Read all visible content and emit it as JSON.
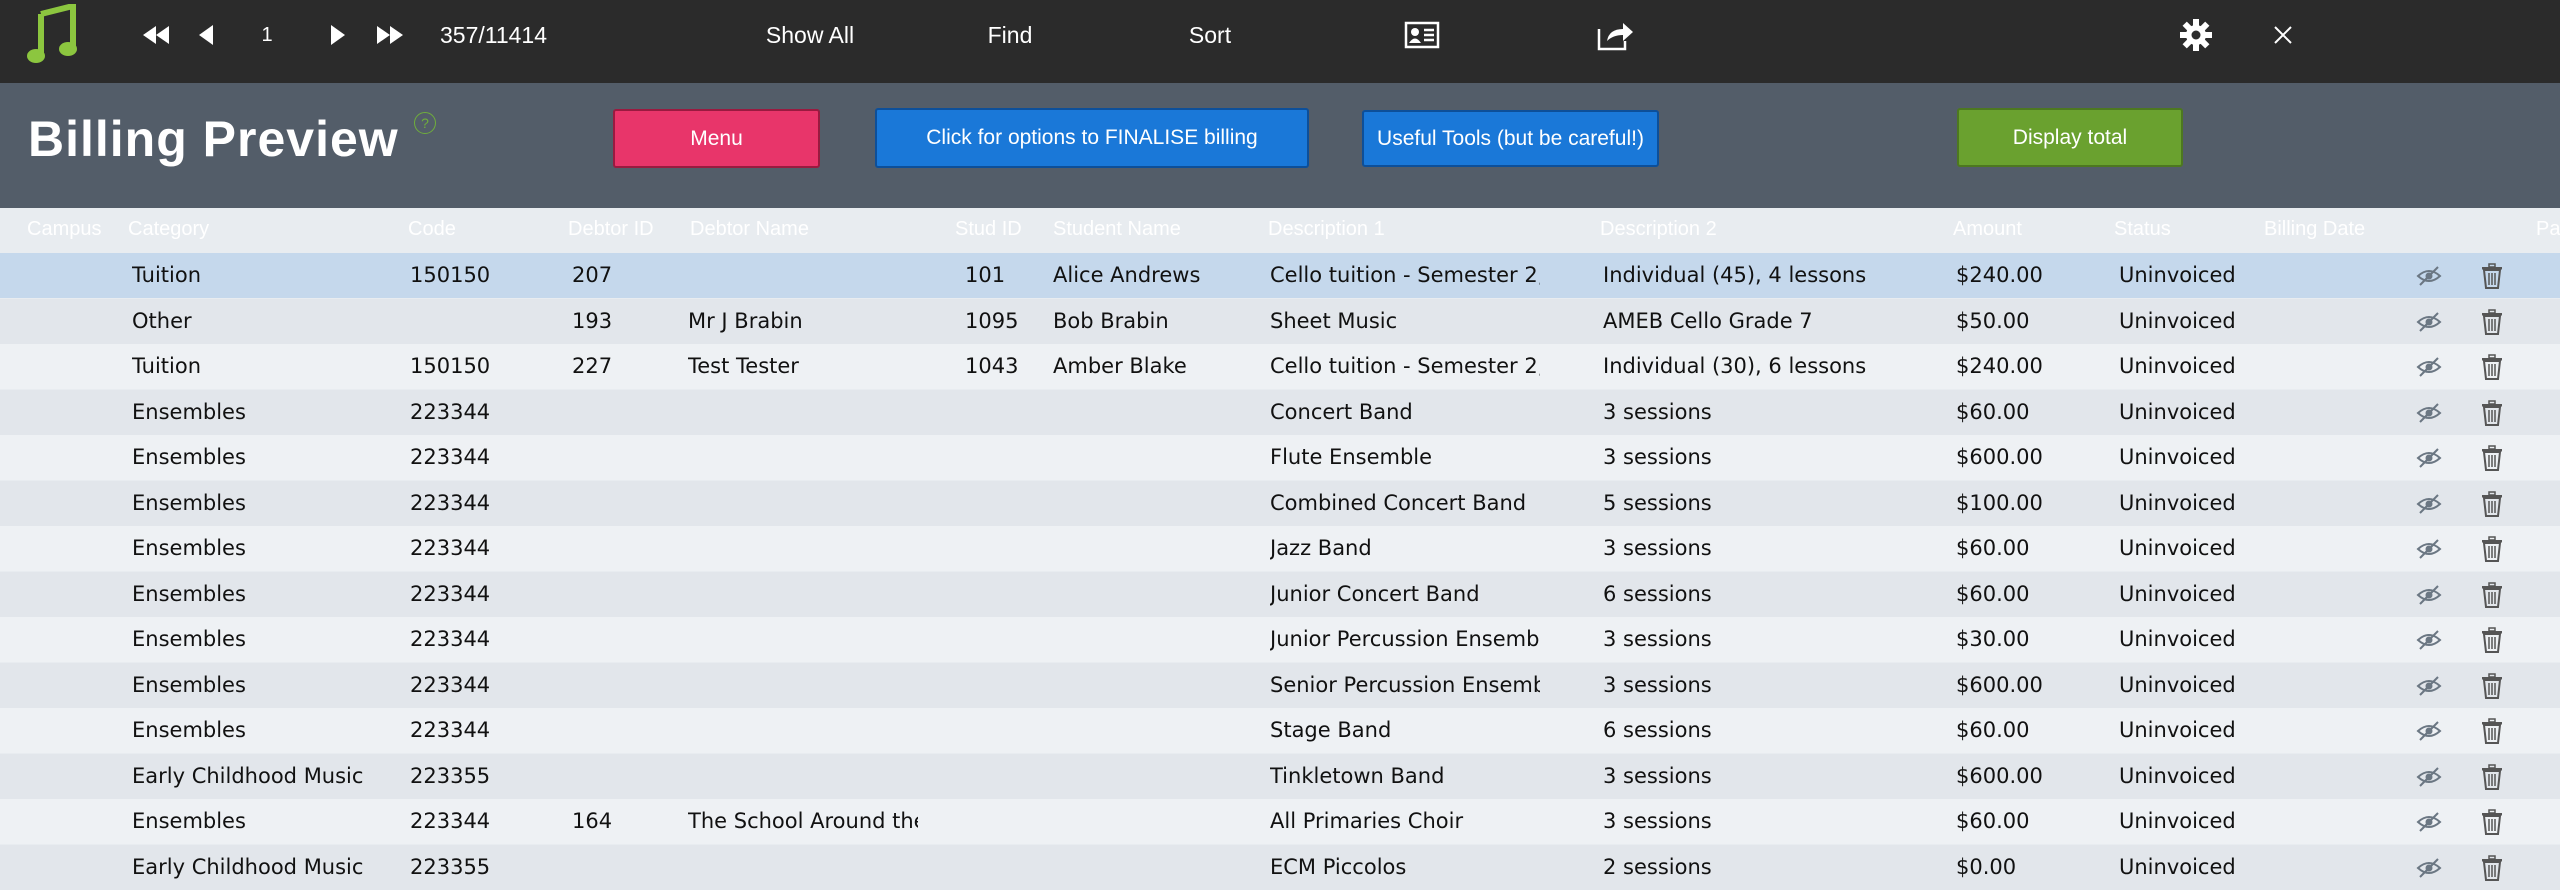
{
  "toolbar": {
    "record_current": "1",
    "record_count": "357/11414",
    "show_all": "Show All",
    "find": "Find",
    "sort": "Sort"
  },
  "header": {
    "title": "Billing Preview",
    "help": "?",
    "menu_button": "Menu",
    "finalise_button": "Click for options to FINALISE billing",
    "tools_button": "Useful Tools (but be careful!)",
    "total_button": "Display total"
  },
  "colors": {
    "toolbar_bg": "#2b2b2b",
    "header_bg": "#535d69",
    "menu_button": "#e8356a",
    "blue_button": "#1a78d8",
    "green_button": "#6aa12f",
    "selected_row": "#c5d8ec",
    "row_light": "#eef1f4",
    "row_dark": "#e2e6eb",
    "logo_green": "#8cc63f"
  },
  "columns": [
    "Campus",
    "Category",
    "Code",
    "Debtor ID",
    "Debtor Name",
    "Stud ID",
    "Student Name",
    "Description 1",
    "Description 2",
    "Amount",
    "Status",
    "Billing Date",
    "Pa"
  ],
  "rows": [
    {
      "category": "Tuition",
      "code": "150150",
      "debtor_id": "207",
      "debtor_name": "",
      "stud_id": "101",
      "student_name": "Alice Andrews",
      "desc1": "Cello tuition - Semester 2,",
      "desc2": "Individual (45), 4 lessons",
      "amount": "$240.00",
      "status": "Uninvoiced",
      "selected": true
    },
    {
      "category": "Other",
      "code": "",
      "debtor_id": "193",
      "debtor_name": "Mr J Brabin",
      "stud_id": "1095",
      "student_name": "Bob Brabin",
      "desc1": "Sheet Music",
      "desc2": "AMEB Cello Grade 7",
      "amount": "$50.00",
      "status": "Uninvoiced"
    },
    {
      "category": "Tuition",
      "code": "150150",
      "debtor_id": "227",
      "debtor_name": "Test Tester",
      "stud_id": "1043",
      "student_name": "Amber Blake",
      "desc1": "Cello tuition - Semester 2,",
      "desc2": "Individual (30), 6 lessons",
      "amount": "$240.00",
      "status": "Uninvoiced"
    },
    {
      "category": "Ensembles",
      "code": "223344",
      "debtor_id": "",
      "debtor_name": "",
      "stud_id": "",
      "student_name": "",
      "desc1": "Concert Band",
      "desc2": "3 sessions",
      "amount": "$60.00",
      "status": "Uninvoiced"
    },
    {
      "category": "Ensembles",
      "code": "223344",
      "debtor_id": "",
      "debtor_name": "",
      "stud_id": "",
      "student_name": "",
      "desc1": "Flute Ensemble",
      "desc2": "3 sessions",
      "amount": "$600.00",
      "status": "Uninvoiced"
    },
    {
      "category": "Ensembles",
      "code": "223344",
      "debtor_id": "",
      "debtor_name": "",
      "stud_id": "",
      "student_name": "",
      "desc1": "Combined Concert Band",
      "desc2": "5 sessions",
      "amount": "$100.00",
      "status": "Uninvoiced"
    },
    {
      "category": "Ensembles",
      "code": "223344",
      "debtor_id": "",
      "debtor_name": "",
      "stud_id": "",
      "student_name": "",
      "desc1": "Jazz Band",
      "desc2": "3 sessions",
      "amount": "$60.00",
      "status": "Uninvoiced"
    },
    {
      "category": "Ensembles",
      "code": "223344",
      "debtor_id": "",
      "debtor_name": "",
      "stud_id": "",
      "student_name": "",
      "desc1": "Junior Concert Band",
      "desc2": "6 sessions",
      "amount": "$60.00",
      "status": "Uninvoiced"
    },
    {
      "category": "Ensembles",
      "code": "223344",
      "debtor_id": "",
      "debtor_name": "",
      "stud_id": "",
      "student_name": "",
      "desc1": "Junior Percussion Ensemble",
      "desc2": "3 sessions",
      "amount": "$30.00",
      "status": "Uninvoiced"
    },
    {
      "category": "Ensembles",
      "code": "223344",
      "debtor_id": "",
      "debtor_name": "",
      "stud_id": "",
      "student_name": "",
      "desc1": "Senior Percussion Ensemble",
      "desc2": "3 sessions",
      "amount": "$600.00",
      "status": "Uninvoiced"
    },
    {
      "category": "Ensembles",
      "code": "223344",
      "debtor_id": "",
      "debtor_name": "",
      "stud_id": "",
      "student_name": "",
      "desc1": "Stage Band",
      "desc2": "6 sessions",
      "amount": "$60.00",
      "status": "Uninvoiced"
    },
    {
      "category": "Early Childhood Music",
      "code": "223355",
      "debtor_id": "",
      "debtor_name": "",
      "stud_id": "",
      "student_name": "",
      "desc1": "Tinkletown Band",
      "desc2": "3 sessions",
      "amount": "$600.00",
      "status": "Uninvoiced"
    },
    {
      "category": "Ensembles",
      "code": "223344",
      "debtor_id": "164",
      "debtor_name": "The School Around the",
      "stud_id": "",
      "student_name": "",
      "desc1": "All Primaries Choir",
      "desc2": "3 sessions",
      "amount": "$60.00",
      "status": "Uninvoiced"
    },
    {
      "category": "Early Childhood Music",
      "code": "223355",
      "debtor_id": "",
      "debtor_name": "",
      "stud_id": "",
      "student_name": "",
      "desc1": "ECM Piccolos",
      "desc2": "2 sessions",
      "amount": "$0.00",
      "status": "Uninvoiced"
    }
  ]
}
